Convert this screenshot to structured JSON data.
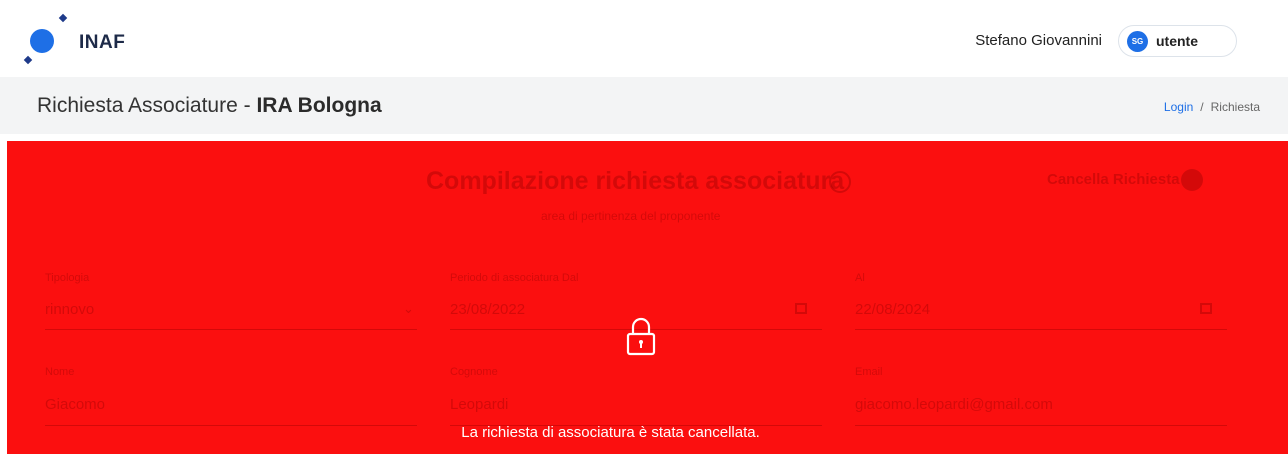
{
  "header": {
    "logo_text": "INAF",
    "user_name": "Stefano Giovannini",
    "avatar_initials": "SG",
    "role": "utente"
  },
  "titlebar": {
    "title_prefix": "Richiesta Associature - ",
    "title_bold": "IRA Bologna",
    "breadcrumb": {
      "login": "Login",
      "separator": "/",
      "current": "Richiesta"
    }
  },
  "form": {
    "title": "Compilazione richiesta associatura",
    "subtitle": "area di pertinenza del proponente",
    "cancel_label": "Cancella Richiesta",
    "fields": {
      "tipologia_label": "Tipologia",
      "tipologia_value": "rinnovo",
      "periodo_label": "Periodo di associatura Dal",
      "periodo_value": "23/08/2022",
      "al_label": "Al",
      "al_value": "22/08/2024",
      "nome_label": "Nome",
      "nome_value": "Giacomo",
      "cognome_label": "Cognome",
      "cognome_value": "Leopardi",
      "email_label": "Email",
      "email_value": "giacomo.leopardi@gmail.com"
    }
  },
  "overlay": {
    "message": "La richiesta di associatura è stata cancellata.",
    "background_color": "#fb0f0f",
    "icon": "lock-icon"
  }
}
